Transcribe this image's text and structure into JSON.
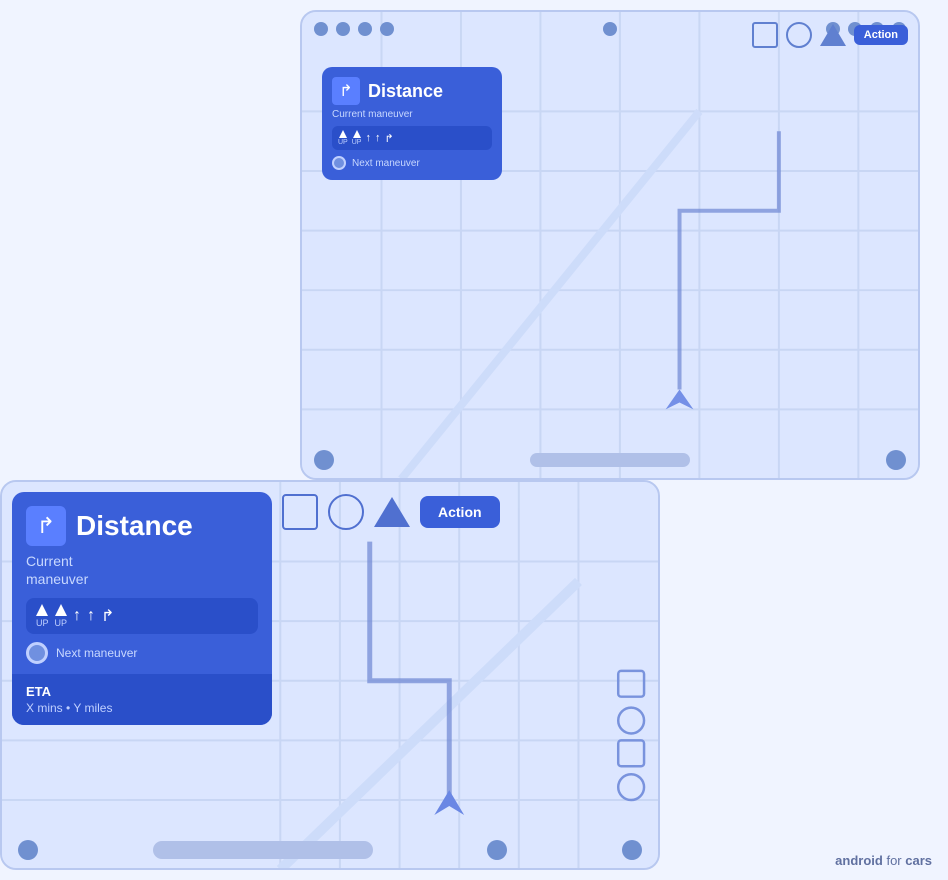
{
  "brand": {
    "text_android": "android",
    "text_for": "for",
    "text_cars": "cars"
  },
  "small_card": {
    "distance": "Distance",
    "current_maneuver": "Current maneuver",
    "next_maneuver": "Next maneuver",
    "action_button": "Action",
    "lanes": [
      {
        "label": "UP",
        "type": "up"
      },
      {
        "label": "UP",
        "type": "up"
      },
      {
        "label": "",
        "type": "straight"
      },
      {
        "label": "",
        "type": "straight"
      },
      {
        "label": "",
        "type": "turn-right"
      }
    ]
  },
  "large_card": {
    "distance": "Distance",
    "current_maneuver": "Current\nmaneuver",
    "next_maneuver": "Next maneuver",
    "action_button": "Action",
    "eta_label": "ETA",
    "eta_value": "X mins • Y miles",
    "lanes": [
      {
        "label": "UP",
        "type": "up"
      },
      {
        "label": "UP",
        "type": "up"
      },
      {
        "label": "",
        "type": "straight"
      },
      {
        "label": "",
        "type": "straight"
      },
      {
        "label": "",
        "type": "turn-right"
      }
    ]
  }
}
